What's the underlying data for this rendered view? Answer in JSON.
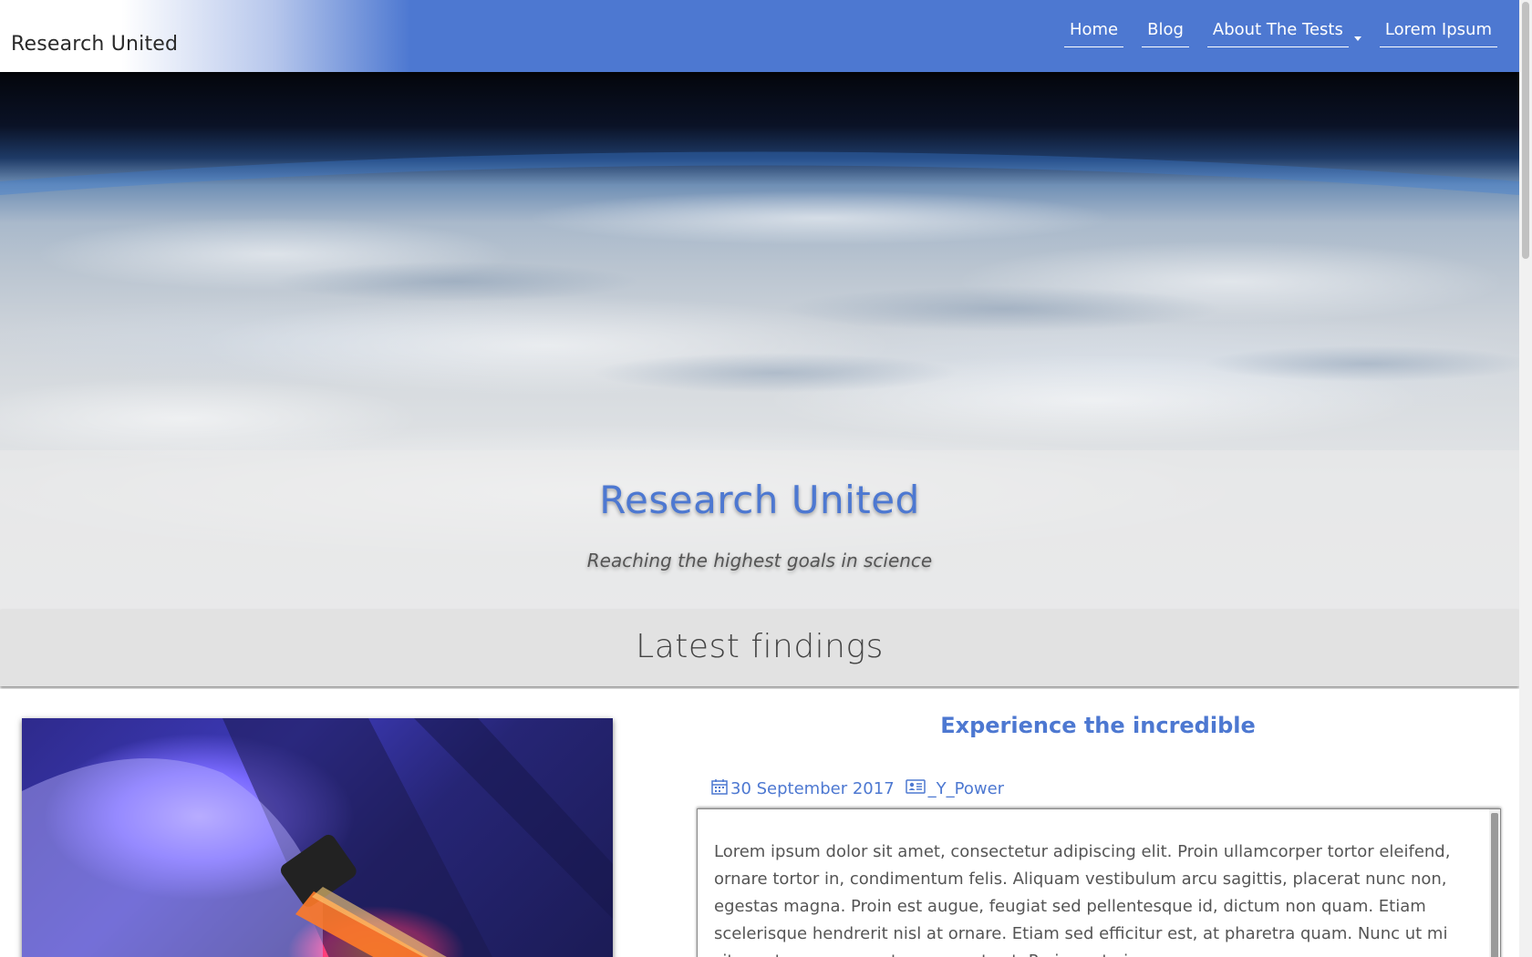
{
  "navbar": {
    "brand": "Research United",
    "items": [
      {
        "label": "Home"
      },
      {
        "label": "Blog"
      },
      {
        "label": "About The Tests"
      },
      {
        "label": "Lorem Ipsum"
      }
    ]
  },
  "hero": {
    "title": "Research United",
    "subtitle": "Reaching the highest goals in science"
  },
  "section": {
    "title": "Latest findings"
  },
  "article": {
    "title": "Experience the incredible",
    "date": "30 September 2017",
    "author": "_Y_Power",
    "body": "Lorem ipsum dolor sit amet, consectetur adipiscing elit. Proin ullamcorper tortor eleifend, ornare tortor in, condimentum felis. Aliquam vestibulum arcu sagittis, placerat nunc non, egestas magna. Proin est augue, feugiat sed pellentesque id, dictum non quam. Etiam scelerisque hendrerit nisl at ornare. Etiam sed efficitur est, at pharetra quam. Nunc ut mi sit amet nunc cursus tempor a et est. Proin porta ipsum"
  },
  "colors": {
    "accent": "#4d78d1",
    "section_bg": "#e2e2e2"
  },
  "icons": {
    "date": "calendar-icon",
    "author": "id-card-icon",
    "dropdown": "caret-down-icon"
  }
}
